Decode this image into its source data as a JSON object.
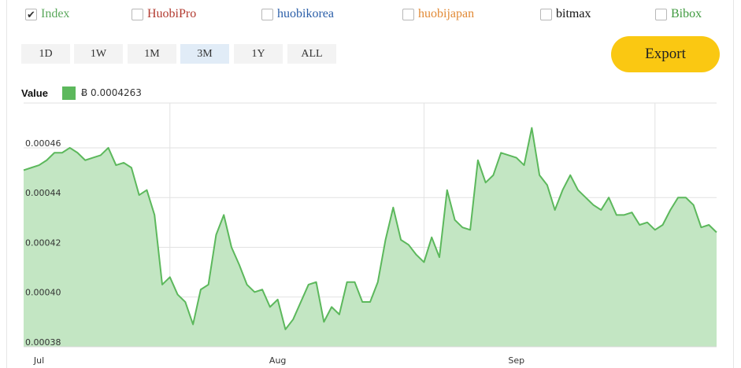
{
  "exchanges": [
    {
      "label": "Index",
      "checked": true,
      "color": "#5ba85c"
    },
    {
      "label": "HuobiPro",
      "checked": false,
      "color": "#b23a30"
    },
    {
      "label": "huobikorea",
      "checked": false,
      "color": "#2a5ea8"
    },
    {
      "label": "huobijapan",
      "checked": false,
      "color": "#e28a36"
    },
    {
      "label": "bitmax",
      "checked": false,
      "color": "#111111"
    },
    {
      "label": "Bibox",
      "checked": false,
      "color": "#3f9a3f"
    }
  ],
  "ranges": [
    {
      "label": "1D",
      "active": false
    },
    {
      "label": "1W",
      "active": false
    },
    {
      "label": "1M",
      "active": false
    },
    {
      "label": "3M",
      "active": true
    },
    {
      "label": "1Y",
      "active": false
    },
    {
      "label": "ALL",
      "active": false
    }
  ],
  "export_label": "Export",
  "legend": {
    "title": "Value",
    "value": "Ƀ 0.0004263",
    "color": "#5cb85c"
  },
  "chart_data": {
    "type": "area",
    "series": [
      {
        "name": "Value",
        "values": [
          0.000451,
          0.000452,
          0.000453,
          0.000455,
          0.000458,
          0.000458,
          0.00046,
          0.000458,
          0.000455,
          0.000456,
          0.000457,
          0.00046,
          0.000453,
          0.000454,
          0.000452,
          0.000441,
          0.000443,
          0.000433,
          0.000405,
          0.000408,
          0.000401,
          0.000398,
          0.000389,
          0.000403,
          0.000405,
          0.000425,
          0.000433,
          0.00042,
          0.000413,
          0.000405,
          0.000402,
          0.000403,
          0.000396,
          0.000399,
          0.000387,
          0.000391,
          0.000398,
          0.000405,
          0.000406,
          0.00039,
          0.000396,
          0.000393,
          0.000406,
          0.000406,
          0.000398,
          0.000398,
          0.000406,
          0.000423,
          0.000436,
          0.000423,
          0.000421,
          0.000417,
          0.000414,
          0.000424,
          0.000416,
          0.000443,
          0.000431,
          0.000428,
          0.000427,
          0.000455,
          0.000446,
          0.000449,
          0.000458,
          0.000457,
          0.000456,
          0.000453,
          0.000468,
          0.000449,
          0.000445,
          0.000435,
          0.000443,
          0.000449,
          0.000443,
          0.00044,
          0.000437,
          0.000435,
          0.00044,
          0.000433,
          0.000433,
          0.000434,
          0.000429,
          0.00043,
          0.000427,
          0.000429,
          0.000435,
          0.00044,
          0.00044,
          0.000437,
          0.000428,
          0.000429,
          0.000426
        ]
      }
    ],
    "x_ticks": [
      {
        "label": "Jul",
        "index": 2
      },
      {
        "label": "Aug",
        "index": 33
      },
      {
        "label": "Sep",
        "index": 64
      }
    ],
    "vertical_gridlines_at_index": [
      19,
      52,
      82
    ],
    "y_ticks": [
      0.00038,
      0.0004,
      0.00042,
      0.00044,
      0.00046
    ],
    "ylim": [
      0.00038,
      0.000478
    ],
    "grid": true,
    "legend_position": "top-left",
    "line_color": "#5cb85c",
    "fill_color": "#c3e6c3"
  }
}
